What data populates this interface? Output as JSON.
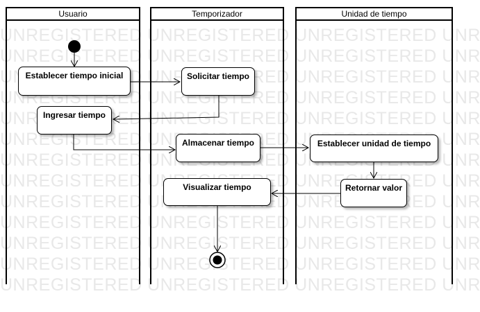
{
  "watermark": "UNREGISTERED UNREGISTERED UNREGISTERED UNREGISTERED",
  "lanes": {
    "usuario": "Usuario",
    "temporizador": "Temporizador",
    "unidad": "Unidad de tiempo"
  },
  "activities": {
    "establecer_tiempo_inicial": "Establecer tiempo inicial",
    "solicitar_tiempo": "Solicitar tiempo",
    "ingresar_tiempo": "Ingresar tiempo",
    "almacenar_tiempo": "Almacenar tiempo",
    "establecer_unidad": "Establecer unidad de tiempo",
    "visualizar_tiempo": "Visualizar tiempo",
    "retornar_valor": "Retornar valor"
  }
}
